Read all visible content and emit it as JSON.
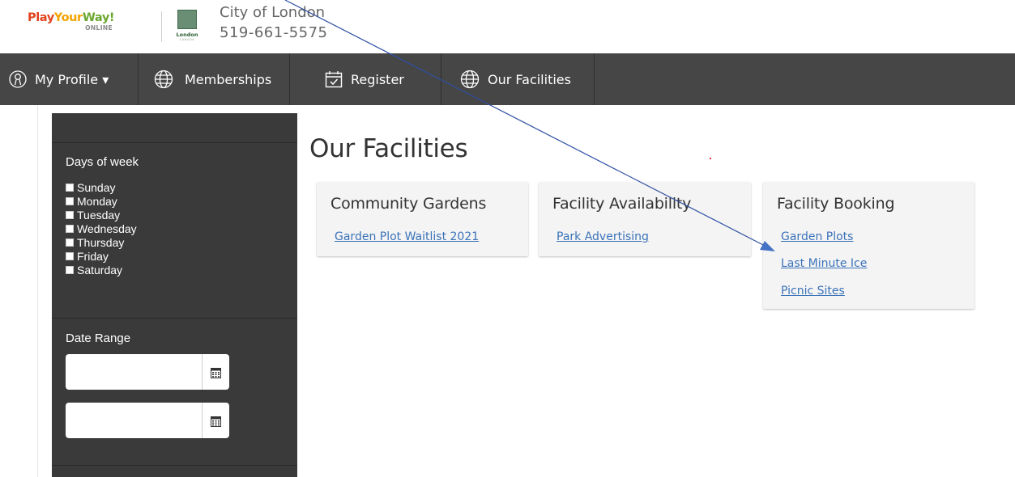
{
  "header": {
    "brand_play": "Play",
    "brand_your": "Your",
    "brand_way": "Way!",
    "brand_online": "ONLINE",
    "london_logo_text": "London",
    "london_logo_sub": "CANADA",
    "city": "City of London",
    "phone": "519-661-5575"
  },
  "nav": {
    "items": [
      {
        "label": "My Profile ▾",
        "icon": "user-circle-icon"
      },
      {
        "label": "Memberships",
        "icon": "globe-icon"
      },
      {
        "label": "Register",
        "icon": "calendar-check-icon"
      },
      {
        "label": "Our Facilities",
        "icon": "globe-icon"
      }
    ]
  },
  "sidebar": {
    "days_title": "Days of week",
    "days": [
      "Sunday",
      "Monday",
      "Tuesday",
      "Wednesday",
      "Thursday",
      "Friday",
      "Saturday"
    ],
    "date_range_title": "Date Range",
    "date_from_value": "",
    "date_to_value": ""
  },
  "main": {
    "title": "Our Facilities",
    "cards": [
      {
        "title": "Community Gardens",
        "links": [
          "Garden Plot Waitlist 2021"
        ]
      },
      {
        "title": "Facility Availability",
        "links": [
          "Park Advertising"
        ]
      },
      {
        "title": "Facility Booking",
        "links": [
          "Garden Plots",
          "Last Minute Ice",
          "Picnic Sites"
        ]
      }
    ]
  },
  "colors": {
    "nav_bg": "#464646",
    "sidebar_bg": "#3a3a3a",
    "link": "#3b73b9",
    "card_bg": "#f4f4f4",
    "annotation_arrow": "#2f4fa3"
  }
}
